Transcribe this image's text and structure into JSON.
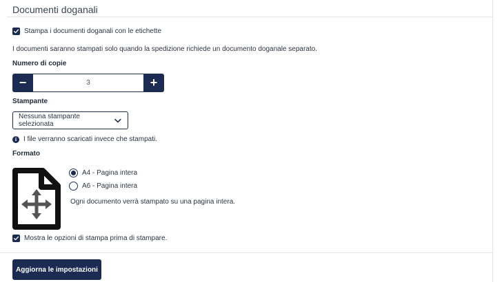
{
  "section": {
    "title": "Documenti doganali"
  },
  "print_with_labels": {
    "label": "Stampa i documenti doganali con le etichette",
    "checked": true
  },
  "info_text": "I documenti saranno stampati solo quando la spedizione richiede un documento doganale separato.",
  "copies": {
    "label": "Numero di copie",
    "value": "3",
    "minus_symbol": "−",
    "plus_symbol": "+"
  },
  "printer": {
    "label": "Stampante",
    "selected": "Nessuna stampante selezionata",
    "hint": "I file verranno scaricati invece che stampati.",
    "hint_icon": "info-icon"
  },
  "format": {
    "label": "Formato",
    "icon": "file-move-icon",
    "options": [
      {
        "label": "A4 - Pagina intera",
        "selected": true
      },
      {
        "label": "A6 - Pagina intera",
        "selected": false
      }
    ],
    "description": "Ogni documento verrà stampato su una pagina intera."
  },
  "show_print_options": {
    "label": "Mostra le opzioni di stampa prima di stampare.",
    "checked": true
  },
  "actions": {
    "update_label": "Aggiorna le impostazioni"
  },
  "colors": {
    "accent": "#1b2b52",
    "divider": "#e5e7eb"
  }
}
